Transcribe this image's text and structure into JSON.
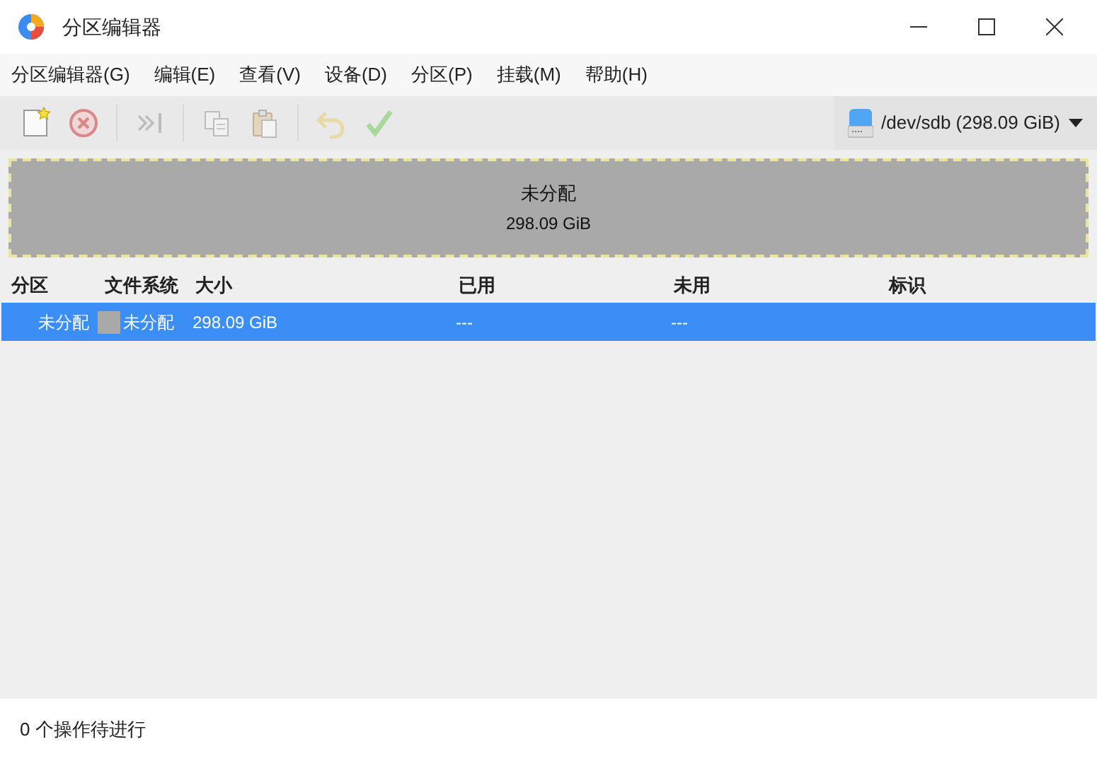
{
  "window": {
    "title": "分区编辑器"
  },
  "menu": [
    "分区编辑器(G)",
    "编辑(E)",
    "查看(V)",
    "设备(D)",
    "分区(P)",
    "挂载(M)",
    "帮助(H)"
  ],
  "toolbar": [
    {
      "kind": "new",
      "disabled": false
    },
    {
      "kind": "delete",
      "disabled": true
    },
    {
      "kind": "sep"
    },
    {
      "kind": "resize",
      "disabled": true
    },
    {
      "kind": "sep"
    },
    {
      "kind": "copy",
      "disabled": true
    },
    {
      "kind": "paste",
      "disabled": true
    },
    {
      "kind": "sep"
    },
    {
      "kind": "undo",
      "disabled": true
    },
    {
      "kind": "apply",
      "disabled": true
    }
  ],
  "device": {
    "label": "/dev/sdb (298.09 GiB)"
  },
  "partition_map": {
    "name": "未分配",
    "size": "298.09 GiB"
  },
  "table": {
    "columns": [
      "分区",
      "文件系统",
      "大小",
      "已用",
      "未用",
      "标识"
    ],
    "rows": [
      {
        "partition": "未分配",
        "filesystem": "未分配",
        "color": "#a9a9a9",
        "size": "298.09 GiB",
        "used": "---",
        "unused": "---",
        "selected": true
      }
    ]
  },
  "status_bar": "0 个操作待进行"
}
